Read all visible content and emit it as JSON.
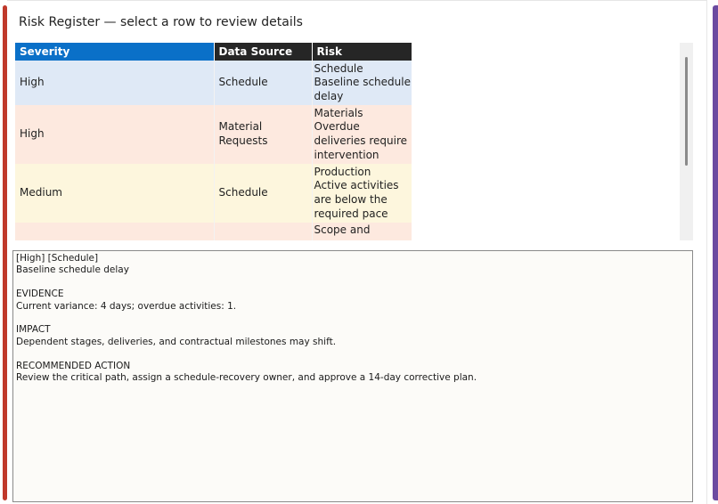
{
  "title": "Risk Register — select a row to review details",
  "grid": {
    "columns": [
      "Severity",
      "Data Source",
      "Risk"
    ],
    "rows": [
      {
        "severity": "High",
        "source": "Schedule",
        "category": "Schedule",
        "risk": "Baseline schedule delay",
        "color": "#dfe9f6"
      },
      {
        "severity": "High",
        "source": "Material Requests",
        "category": "Materials",
        "risk": "Overdue deliveries require intervention",
        "color": "#fde9df"
      },
      {
        "severity": "Medium",
        "source": "Schedule",
        "category": "Production",
        "risk": "Active activities are below the required pace",
        "color": "#fdf6dd"
      },
      {
        "severity": "",
        "source": "",
        "category": "Scope and",
        "risk": "",
        "color": "#fde9df"
      }
    ]
  },
  "detail": {
    "header": "[High] [Schedule]",
    "subtitle": "Baseline schedule delay",
    "evidence_label": "EVIDENCE",
    "evidence": "Current variance: 4 days; overdue activities: 1.",
    "impact_label": "IMPACT",
    "impact": "Dependent stages, deliveries, and contractual milestones may shift.",
    "action_label": "RECOMMENDED ACTION",
    "action": "Review the critical path, assign a schedule-recovery owner, and approve a 14-day corrective plan."
  }
}
